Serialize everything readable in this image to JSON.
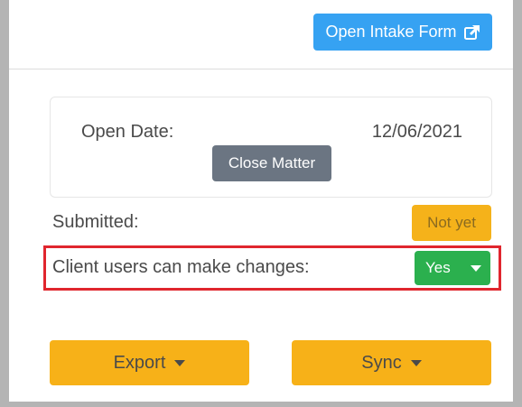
{
  "header": {
    "intake_button_label": "Open Intake Form",
    "intake_icon": "external-link-icon"
  },
  "matter": {
    "open_date_label": "Open Date:",
    "open_date_value": "12/06/2021",
    "close_button_label": "Close Matter"
  },
  "submitted": {
    "label": "Submitted:",
    "status": "Not yet"
  },
  "client_changes": {
    "label": "Client users can make changes:",
    "selected": "Yes"
  },
  "actions": {
    "export_label": "Export",
    "sync_label": "Sync"
  },
  "colors": {
    "primary": "#36a2f2",
    "secondary": "#6b7582",
    "warning": "#f7b118",
    "success": "#2bb04e",
    "highlight": "#e0262e"
  }
}
